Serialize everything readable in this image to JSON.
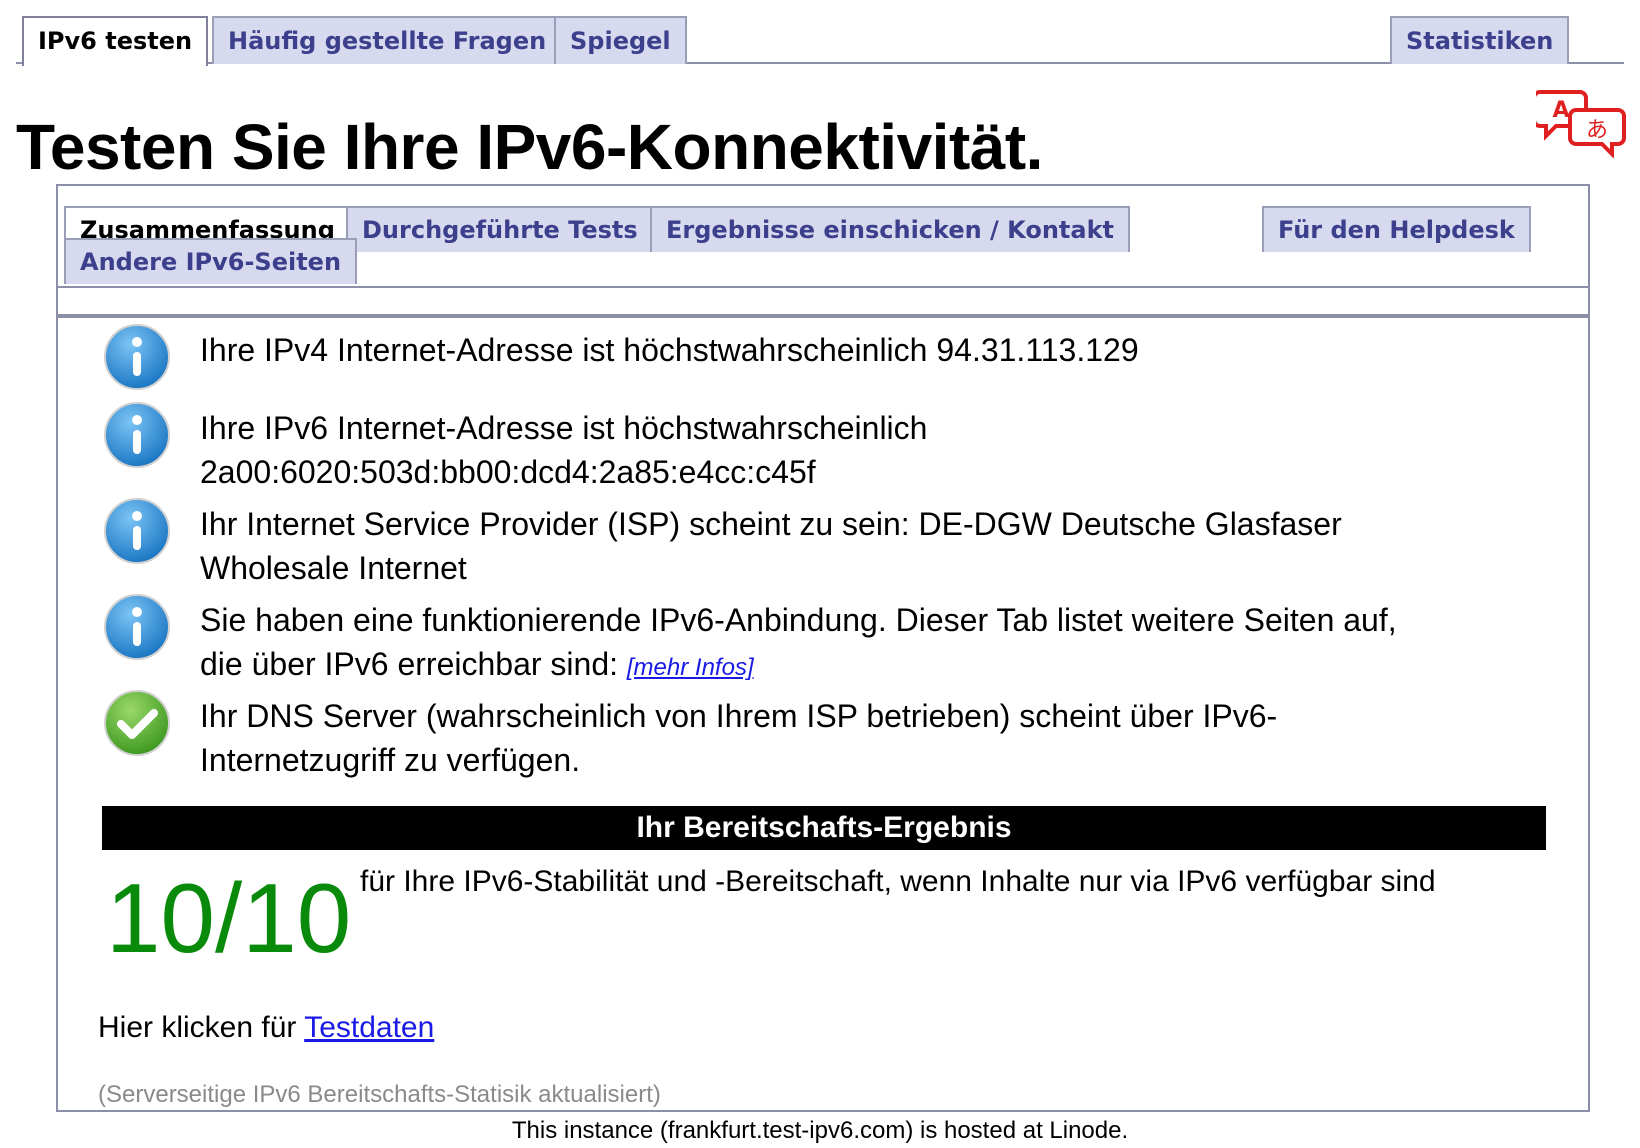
{
  "top_tabs": {
    "test": "IPv6 testen",
    "faq": "Häufig gestellte Fragen",
    "mirror": "Spiegel",
    "stats": "Statistiken"
  },
  "title": "Testen Sie Ihre IPv6-Konnektivität.",
  "inner_tabs": {
    "summary": "Zusammenfassung",
    "tests": "Durchgeführte Tests",
    "submit": "Ergebnisse einschicken / Kontakt",
    "helpdesk": "Für den Helpdesk",
    "other": "Andere IPv6-Seiten"
  },
  "results": [
    {
      "icon": "info-icon",
      "text": "Ihre IPv4 Internet-Adresse ist höchstwahrscheinlich 94.31.113.129"
    },
    {
      "icon": "info-icon",
      "line1": "Ihre IPv6 Internet-Adresse ist höchstwahrscheinlich",
      "line2": "2a00:6020:503d:bb00:dcd4:2a85:e4cc:c45f"
    },
    {
      "icon": "info-icon",
      "line1": "Ihr Internet Service Provider (ISP) scheint zu sein: DE-DGW Deutsche Glasfaser",
      "line2": "Wholesale Internet"
    },
    {
      "icon": "info-icon",
      "line1": "Sie haben eine funktionierende IPv6-Anbindung. Dieser Tab listet weitere Seiten auf,",
      "line2": "die über IPv6 erreichbar sind:",
      "link": "[mehr Infos]"
    },
    {
      "icon": "check-icon",
      "line1": "Ihr DNS Server (wahrscheinlich von Ihrem ISP betrieben) scheint über IPv6-",
      "line2": "Internetzugriff zu verfügen."
    }
  ],
  "readiness": {
    "header": "Ihr Bereitschafts-Ergebnis",
    "score": "10/10",
    "description": "für Ihre IPv6-Stabilität und -Bereitschaft, wenn Inhalte nur via IPv6 verfügbar sind"
  },
  "testdata": {
    "prefix": "Hier klicken für",
    "link": "Testdaten"
  },
  "stats_note": "(Serverseitige IPv6 Bereitschafts-Statisik aktualisiert)",
  "footer": "This instance (frankfurt.test-ipv6.com) is hosted at Linode.",
  "colors": {
    "tab_bg": "#d7d9ee",
    "tab_text": "#3c3f8c",
    "score_green": "#0a8a0a",
    "info_blue": "#2f8fd8",
    "check_green": "#5fb33a",
    "translate_red": "#e02020"
  }
}
